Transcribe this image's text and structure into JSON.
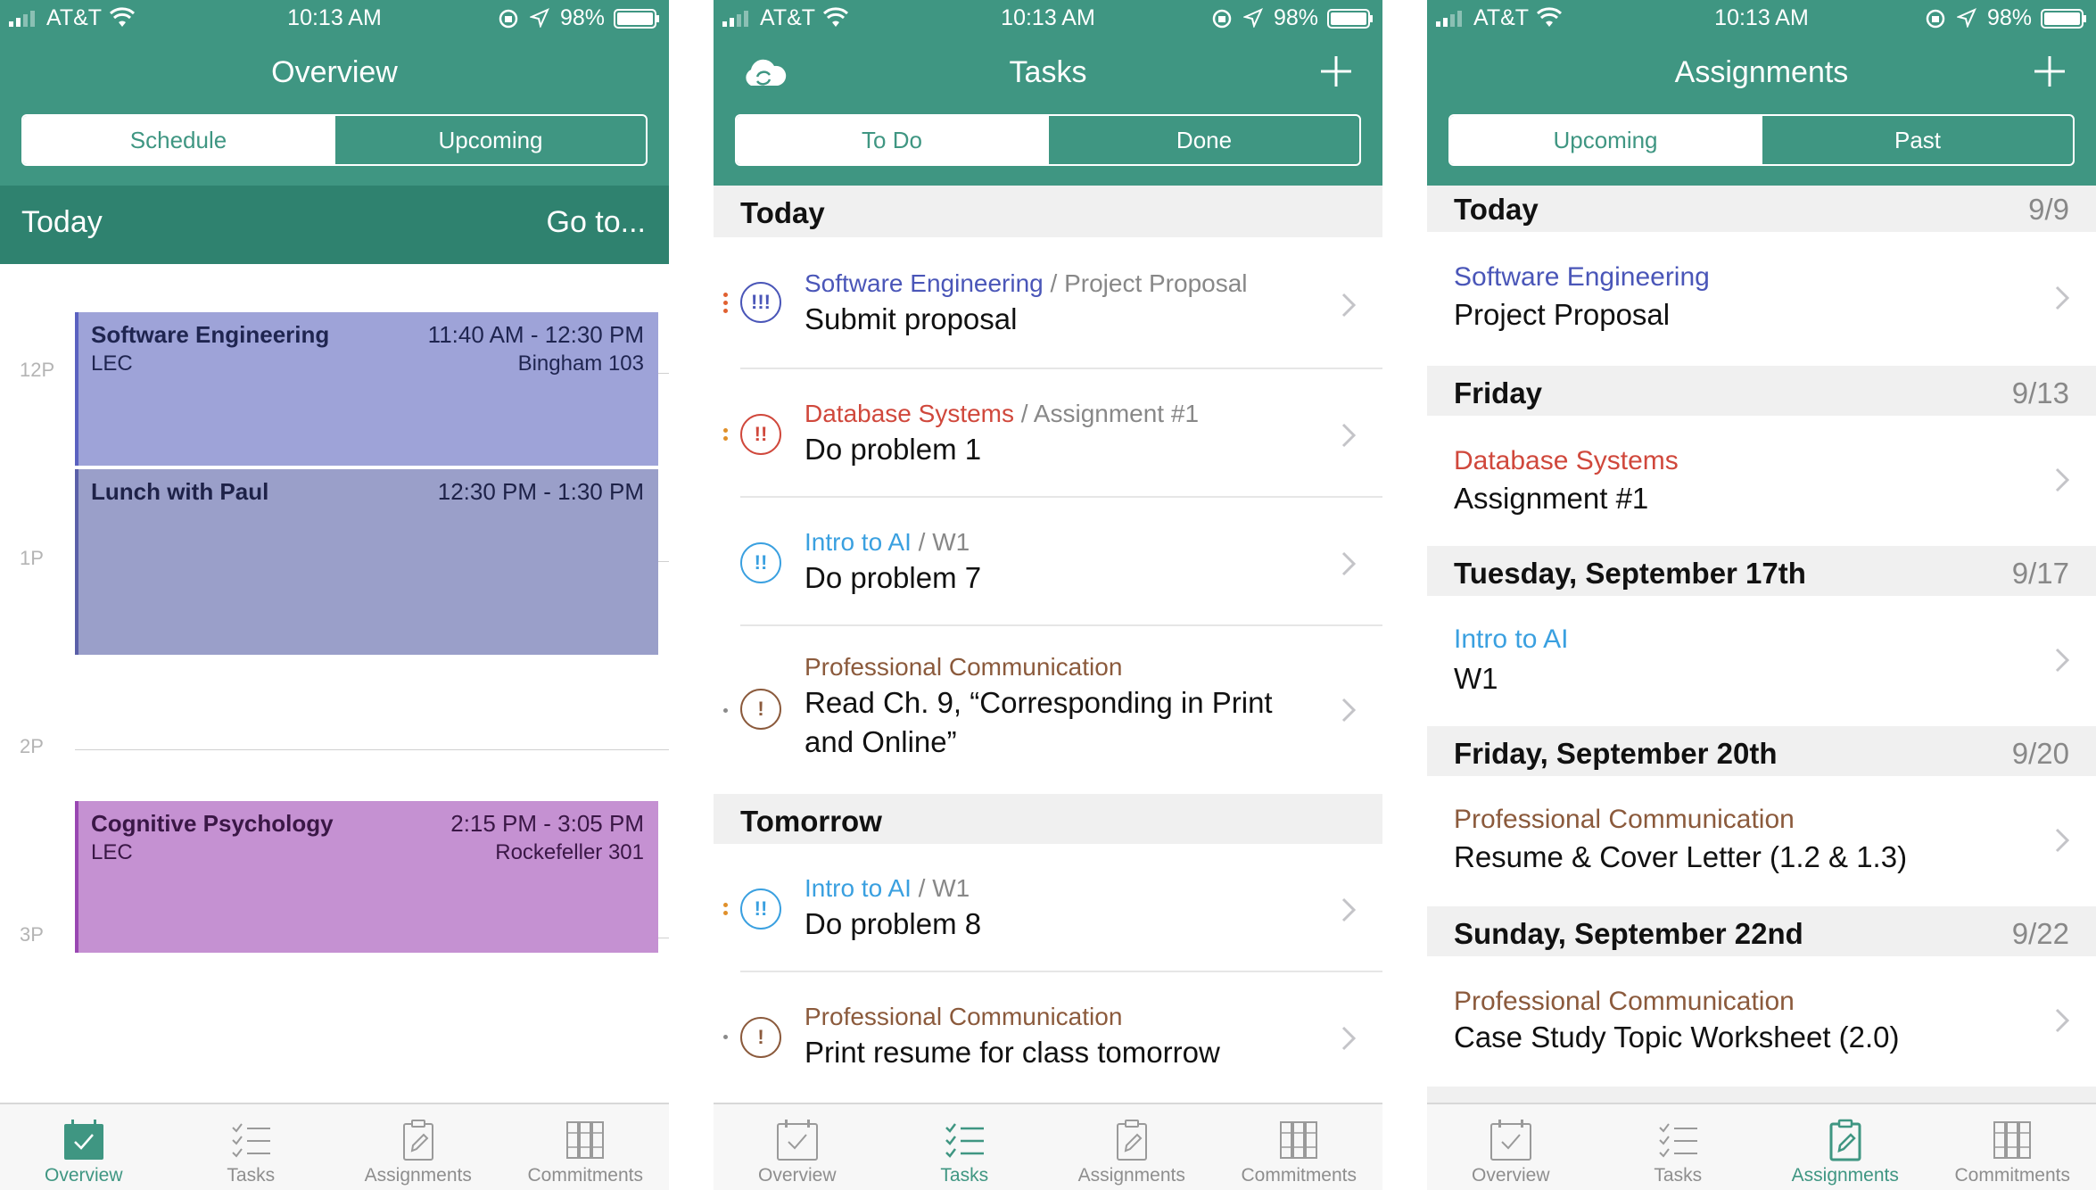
{
  "status": {
    "carrier": "AT&T",
    "time": "10:13 AM",
    "battery": "98%"
  },
  "colors": {
    "teal": "#3f9682",
    "se_blue": "#4a56b8",
    "db_red": "#d0483c",
    "ai_blue": "#3aa0e0",
    "pc_brown": "#8b5a3c"
  },
  "overview": {
    "title": "Overview",
    "segments": [
      "Schedule",
      "Upcoming"
    ],
    "today_label": "Today",
    "goto_label": "Go to...",
    "hours": [
      "12P",
      "1P",
      "2P",
      "3P"
    ],
    "events": [
      {
        "title": "Software Engineering",
        "time": "11:40 AM - 12:30 PM",
        "sub": "LEC",
        "location": "Bingham 103"
      },
      {
        "title": "Lunch with Paul",
        "time": "12:30 PM - 1:30 PM",
        "sub": "",
        "location": ""
      },
      {
        "title": "Cognitive Psychology",
        "time": "2:15 PM - 3:05 PM",
        "sub": "LEC",
        "location": "Rockefeller 301"
      }
    ]
  },
  "tasks": {
    "title": "Tasks",
    "segments": [
      "To Do",
      "Done"
    ],
    "sections": [
      {
        "title": "Today",
        "items": [
          {
            "course": "Software Engineering",
            "sep": " / ",
            "category": "Project Proposal",
            "text": "Submit proposal",
            "priority": "!!!"
          },
          {
            "course": "Database Systems",
            "sep": " / ",
            "category": "Assignment #1",
            "text": "Do problem 1",
            "priority": "!!"
          },
          {
            "course": "Intro to AI",
            "sep": " / ",
            "category": "W1",
            "text": "Do problem 7",
            "priority": "!!"
          },
          {
            "course": "Professional Communication",
            "sep": "",
            "category": "",
            "text": "Read Ch. 9, “Corresponding in Print and Online”",
            "priority": "!"
          }
        ]
      },
      {
        "title": "Tomorrow",
        "items": [
          {
            "course": "Intro to AI",
            "sep": " / ",
            "category": "W1",
            "text": "Do problem 8",
            "priority": "!!"
          },
          {
            "course": "Professional Communication",
            "sep": "",
            "category": "",
            "text": "Print resume for class tomorrow",
            "priority": "!"
          }
        ]
      }
    ]
  },
  "assignments": {
    "title": "Assignments",
    "segments": [
      "Upcoming",
      "Past"
    ],
    "groups": [
      {
        "title": "Today",
        "date": "9/9",
        "course": "Software Engineering",
        "name": "Project Proposal"
      },
      {
        "title": "Friday",
        "date": "9/13",
        "course": "Database Systems",
        "name": "Assignment #1"
      },
      {
        "title": "Tuesday, September 17th",
        "date": "9/17",
        "course": "Intro to AI",
        "name": "W1"
      },
      {
        "title": "Friday, September 20th",
        "date": "9/20",
        "course": "Professional Communication",
        "name": "Resume & Cover Letter (1.2 & 1.3)"
      },
      {
        "title": "Sunday, September 22nd",
        "date": "9/22",
        "course": "Professional Communication",
        "name": "Case Study Topic Worksheet (2.0)"
      }
    ]
  },
  "tabbar": [
    "Overview",
    "Tasks",
    "Assignments",
    "Commitments"
  ]
}
